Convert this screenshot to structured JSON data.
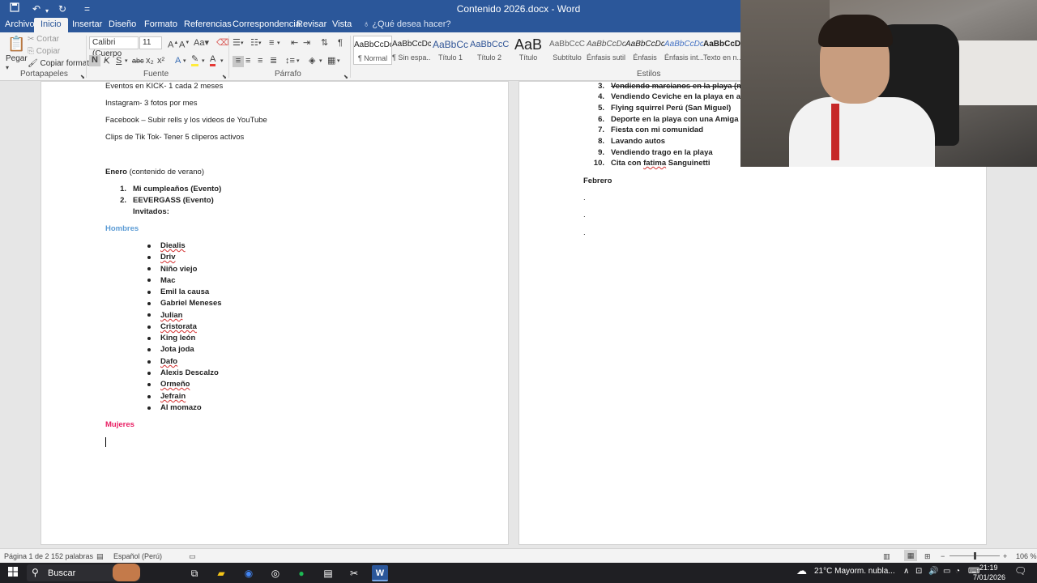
{
  "titlebar": {
    "title": "Contenido 2026.docx - Word",
    "qa": [
      "save-icon",
      "undo-icon",
      "redo-icon",
      "customize-icon"
    ]
  },
  "tabs": [
    {
      "label": "Archivo"
    },
    {
      "label": "Inicio"
    },
    {
      "label": "Insertar"
    },
    {
      "label": "Diseño"
    },
    {
      "label": "Formato"
    },
    {
      "label": "Referencias"
    },
    {
      "label": "Correspondencia"
    },
    {
      "label": "Revisar"
    },
    {
      "label": "Vista"
    }
  ],
  "tell_me": "¿Qué desea hacer?",
  "ribbon": {
    "clipboard": {
      "paste": "Pegar",
      "cut": "Cortar",
      "copy": "Copiar",
      "format_painter": "Copiar formato",
      "label": "Portapapeles"
    },
    "font": {
      "family": "Calibri (Cuerpo",
      "size": "11",
      "label": "Fuente",
      "bold": "N",
      "italic": "K",
      "underline": "S",
      "case": "Aa"
    },
    "paragraph": {
      "label": "Párrafo"
    },
    "styles": {
      "label": "Estilos",
      "items": [
        {
          "preview": "AaBbCcDc",
          "name": "¶ Normal"
        },
        {
          "preview": "AaBbCcDc",
          "name": "¶ Sin espa..."
        },
        {
          "preview": "AaBbCc",
          "name": "Título 1"
        },
        {
          "preview": "AaBbCcC",
          "name": "Título 2"
        },
        {
          "preview": "AaB",
          "name": "Título"
        },
        {
          "preview": "AaBbCcC",
          "name": "Subtítulo"
        },
        {
          "preview": "AaBbCcDc",
          "name": "Énfasis sutil"
        },
        {
          "preview": "AaBbCcDc",
          "name": "Énfasis"
        },
        {
          "preview": "AaBbCcDc",
          "name": "Énfasis int..."
        },
        {
          "preview": "AaBbCcDc",
          "name": "Texto en n..."
        }
      ]
    }
  },
  "page_left": {
    "lines": [
      "Eventos en KICK-  1 cada 2 meses",
      "Instagram- 3 fotos por mes",
      "Facebook – Subir rells y los videos de YouTube",
      "Clips de Tik Tok- Tener 5 cliperos activos"
    ],
    "enero_bold": "Enero",
    "enero_rest": " (contenido de verano)",
    "events": [
      {
        "num": "1.",
        "text": "Mi cumpleaños (Evento)"
      },
      {
        "num": "2.",
        "text": "EEVERGASS (Evento)"
      }
    ],
    "invitados": "Invitados:",
    "hombres_heading": "Hombres",
    "hombres": [
      "Diealis",
      "Driv",
      "Niño viejo",
      "Mac",
      "Emil la causa",
      "Gabriel Meneses",
      "Julian",
      "Cristorata",
      "King león",
      "Jota joda",
      "Dafo",
      "Alexis Descalzo",
      "Ormeño",
      "Jefrain",
      "Al momazo"
    ],
    "mujeres_heading": "Mujeres"
  },
  "page_right": {
    "items": [
      {
        "num": "3.",
        "text": "Vendiendo marcianos en la playa (ma"
      },
      {
        "num": "4.",
        "text": "Vendiendo Ceviche en la playa en alta"
      },
      {
        "num": "5.",
        "text": "Flying squirrel Perú (San Miguel)"
      },
      {
        "num": "6.",
        "text": "Deporte en la playa con una Amiga y"
      },
      {
        "num": "7.",
        "text": "Fiesta con mi comunidad"
      },
      {
        "num": "8.",
        "text": "Lavando autos"
      },
      {
        "num": "9.",
        "text": "Vendiendo trago en la playa"
      },
      {
        "num": "10.",
        "text": "Cita con fatima Sanguinetti"
      }
    ],
    "febrero": "Febrero",
    "dots": [
      ".",
      ".",
      "."
    ]
  },
  "statusbar": {
    "page": "Página 1 de 2",
    "words": "152 palabras",
    "language": "Español (Perú)",
    "zoom": "106 %"
  },
  "taskbar": {
    "search": "Buscar",
    "weather": "21°C  Mayorm. nubla...",
    "time": "21:19",
    "date": "7/01/2026"
  }
}
